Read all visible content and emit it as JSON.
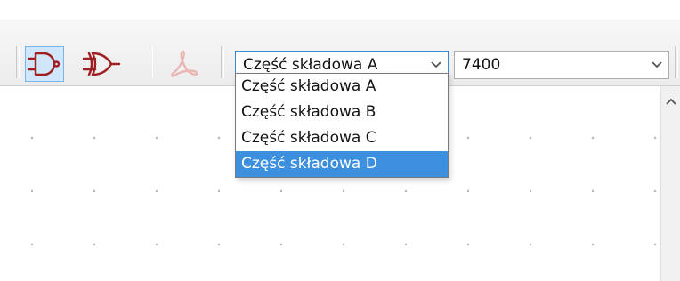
{
  "toolbar": {
    "tools": [
      {
        "icon": "and-gate-icon",
        "active": true
      },
      {
        "icon": "or-gate-icon",
        "active": false
      },
      {
        "icon": "pdf-icon",
        "active": false
      }
    ],
    "unit_select": {
      "value": "Część składowa A"
    },
    "part_select": {
      "value": "7400"
    }
  },
  "dropdown": {
    "options": [
      "Część składowa A",
      "Część składowa B",
      "Część składowa C",
      "Część składowa D"
    ],
    "highlighted": 3
  },
  "colors": {
    "gate": "#a01d20",
    "highlight": "#3d8fe0",
    "active_tool_bg": "#cfe6fb"
  }
}
